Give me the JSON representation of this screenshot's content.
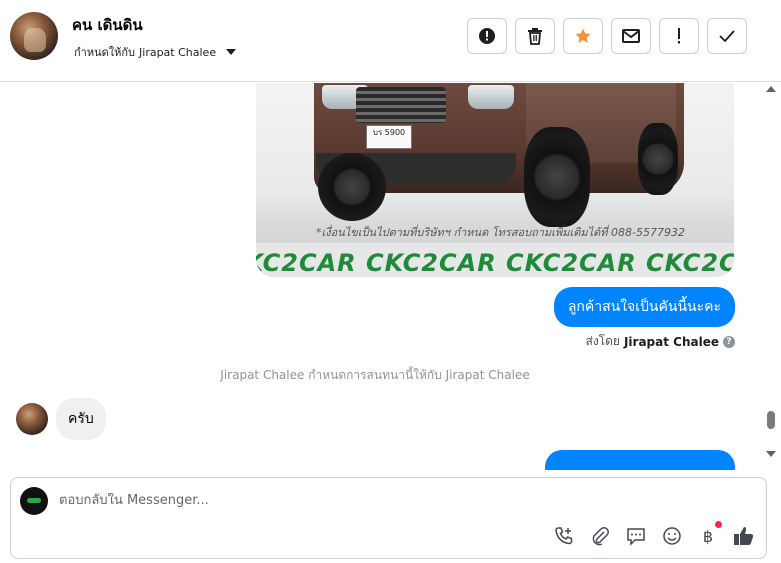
{
  "header": {
    "contact_name": "คน เดินดิน",
    "assign_label": "กำหนดให้กับ",
    "assignee": "Jirapat Chalee",
    "actions": [
      {
        "icon": "alert-circle-icon"
      },
      {
        "icon": "trash-icon"
      },
      {
        "icon": "star-icon",
        "color": "#f7923b"
      },
      {
        "icon": "envelope-icon"
      },
      {
        "icon": "exclamation-icon"
      },
      {
        "icon": "checkmark-icon"
      }
    ]
  },
  "chat": {
    "image": {
      "plate": "บร 5900",
      "caption": "*เงื่อนไขเป็นไปตามที่บริษัทฯ กำหนด โทรสอบถามเพิ่มเติมได้ที่ 088-5577932",
      "banner": "CKC2CAR CKC2CAR CKC2CAR CKC2CAR CKC2CAR CKC2"
    },
    "outgoing_message": "ลูกค้าสนใจเป็นคันนี้นะคะ",
    "sent_by_label": "ส่งโดย",
    "sent_by_name": "Jirapat Chalee",
    "system_note": "Jirapat Chalee กำหนดการสนทนานี้ให้กับ Jirapat Chalee",
    "incoming_message": "ครับ",
    "accent_color": "#0084ff"
  },
  "composer": {
    "placeholder": "ตอบกลับใน Messenger...",
    "tools": [
      "phone-add-icon",
      "paperclip-icon",
      "saved-reply-icon",
      "emoji-icon",
      "baht-payment-icon",
      "thumbs-up-icon"
    ]
  }
}
